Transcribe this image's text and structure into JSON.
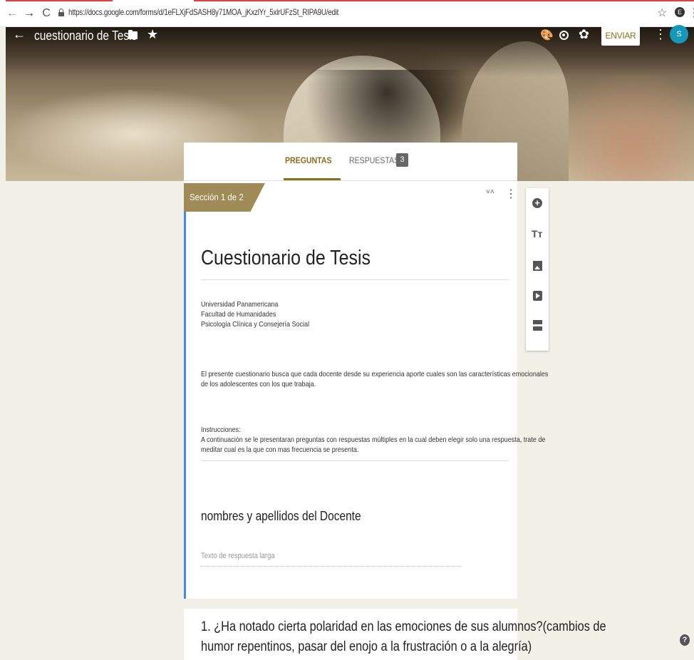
{
  "browser": {
    "back_glyph": "←",
    "forward_glyph": "→",
    "reload_glyph": "C",
    "url": "https://docs.google.com/forms/d/1eFLXjFdSASH8y71MOA_jKxzlYr_5xlrUFzSt_RIPA9U/edit",
    "bookmark_glyph": "☆",
    "extension_label": "E",
    "menu_glyph": "⋮"
  },
  "header": {
    "back_glyph": "←",
    "title": "cuestionario de Tesis",
    "star_glyph": "★",
    "palette_glyph": "🎨",
    "settings_glyph": "✿",
    "send_label": "ENVIAR",
    "more_glyph": "⋮",
    "avatar_initial": "S"
  },
  "tabs": {
    "questions": "PREGUNTAS",
    "responses": "RESPUESTAS",
    "responses_count": "3"
  },
  "section": {
    "label": "Sección 1 de 2",
    "collapse_glyph": "˅˄",
    "more_glyph": "⋮"
  },
  "form": {
    "title": "Cuestionario de Tesis",
    "description_lines": [
      "Universidad Panamericana",
      "Facultad de Humanidades",
      "Psicología Clínica y Consejería Social",
      "El presente cuestionario busca que cada docente desde su experiencia aporte cuales son las características emocionales",
      "de los adolescentes con  los que trabaja.",
      "Instrucciones:",
      "A continuación se le presentaran preguntas con respuestas múltiples en la cual deben elegir solo una respuesta, trate de",
      "meditar cual es la que con mas frecuencia se presenta."
    ]
  },
  "question_name": {
    "title": "nombres y apellidos del Docente",
    "placeholder": "Texto de respuesta larga"
  },
  "question_1": {
    "line1": "1. ¿Ha notado cierta polaridad en las emociones de sus alumnos?(cambios de",
    "line2": "humor repentinos, pasar del enojo a la frustración o a la alegría)"
  },
  "toolbar": {
    "add_glyph": "+",
    "title_glyph": "Tт"
  },
  "help_glyph": "?",
  "colors": {
    "accent": "#8a6d1f",
    "section_tab": "#a08a55",
    "focus_bar": "#4285f4",
    "avatar": "#1597b8",
    "background": "#f2f1e8"
  }
}
